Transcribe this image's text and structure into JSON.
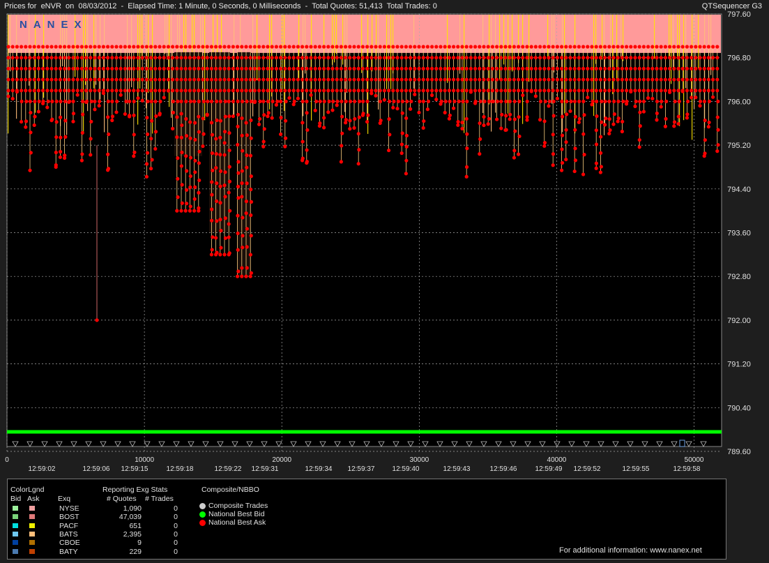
{
  "header": {
    "title": "Prices for  eNVR  on  08/03/2012  -  Elapsed Time: 1 Minute, 0 Seconds, 0 Milliseconds  -  Total Quotes: 51,413  Total Trades: 0",
    "app_name": "QTSequencer G3"
  },
  "colors": {
    "ask_red": "#ff0000",
    "bid_green": "#00ff00",
    "band_pink": "#ff9a9a",
    "band_yellow": "#ffe600",
    "band_orange": "#ffbe7a",
    "grid": "#aaaaaa"
  },
  "chart_data": {
    "type": "line",
    "watermark": "NANEX",
    "y_ticks": [
      "797.60",
      "796.80",
      "796.00",
      "795.20",
      "794.40",
      "793.60",
      "792.80",
      "792.00",
      "791.20",
      "790.40",
      "789.60"
    ],
    "ylim": [
      789.6,
      797.6
    ],
    "x_ticks": [
      "0",
      "10000",
      "20000",
      "30000",
      "40000",
      "50000"
    ],
    "xlim": [
      0,
      52000
    ],
    "time_labels": [
      "12:59:02",
      "12:59:06",
      "12:59:15",
      "12:59:18",
      "12:59:22",
      "12:59:31",
      "12:59:34",
      "12:59:37",
      "12:59:40",
      "12:59:43",
      "12:59:46",
      "12:59:49",
      "12:59:52",
      "12:59:55",
      "12:59:58"
    ],
    "series": [
      {
        "name": "National Best Bid",
        "values_approx": 789.9
      },
      {
        "name": "National Best Ask",
        "range_approx": [
          792.0,
          797.0
        ]
      }
    ]
  },
  "legend": {
    "color_legend": "ColorLgnd",
    "bid": "Bid",
    "ask": "Ask",
    "exq": "Exq",
    "stats_title": "Reporting Exg Stats",
    "quotes_header": "# Quotes",
    "trades_header": "# Trades",
    "composite_title": "Composite/NBBO",
    "exchanges": [
      {
        "name": "NYSE",
        "quotes": "1,090",
        "trades": "0",
        "bid": "#9cf09c",
        "ask": "#f0a0a0"
      },
      {
        "name": "BOST",
        "quotes": "47,039",
        "trades": "0",
        "bid": "#7ad27a",
        "ask": "#e07a7a"
      },
      {
        "name": "PACF",
        "quotes": "651",
        "trades": "0",
        "bid": "#00e0e0",
        "ask": "#f0f000"
      },
      {
        "name": "BATS",
        "quotes": "2,395",
        "trades": "0",
        "bid": "#6ec8f0",
        "ask": "#ffbe7a"
      },
      {
        "name": "CBOE",
        "quotes": "9",
        "trades": "0",
        "bid": "#0040a0",
        "ask": "#b07000"
      },
      {
        "name": "BATY",
        "quotes": "229",
        "trades": "0",
        "bid": "#4a7ab0",
        "ask": "#c04000"
      }
    ],
    "composite": [
      {
        "label": "Composite Trades",
        "color": "#cccccc"
      },
      {
        "label": "National Best Bid",
        "color": "#00ff00"
      },
      {
        "label": "National Best Ask",
        "color": "#ff0000"
      }
    ],
    "info": "For additional information: www.nanex.net"
  }
}
